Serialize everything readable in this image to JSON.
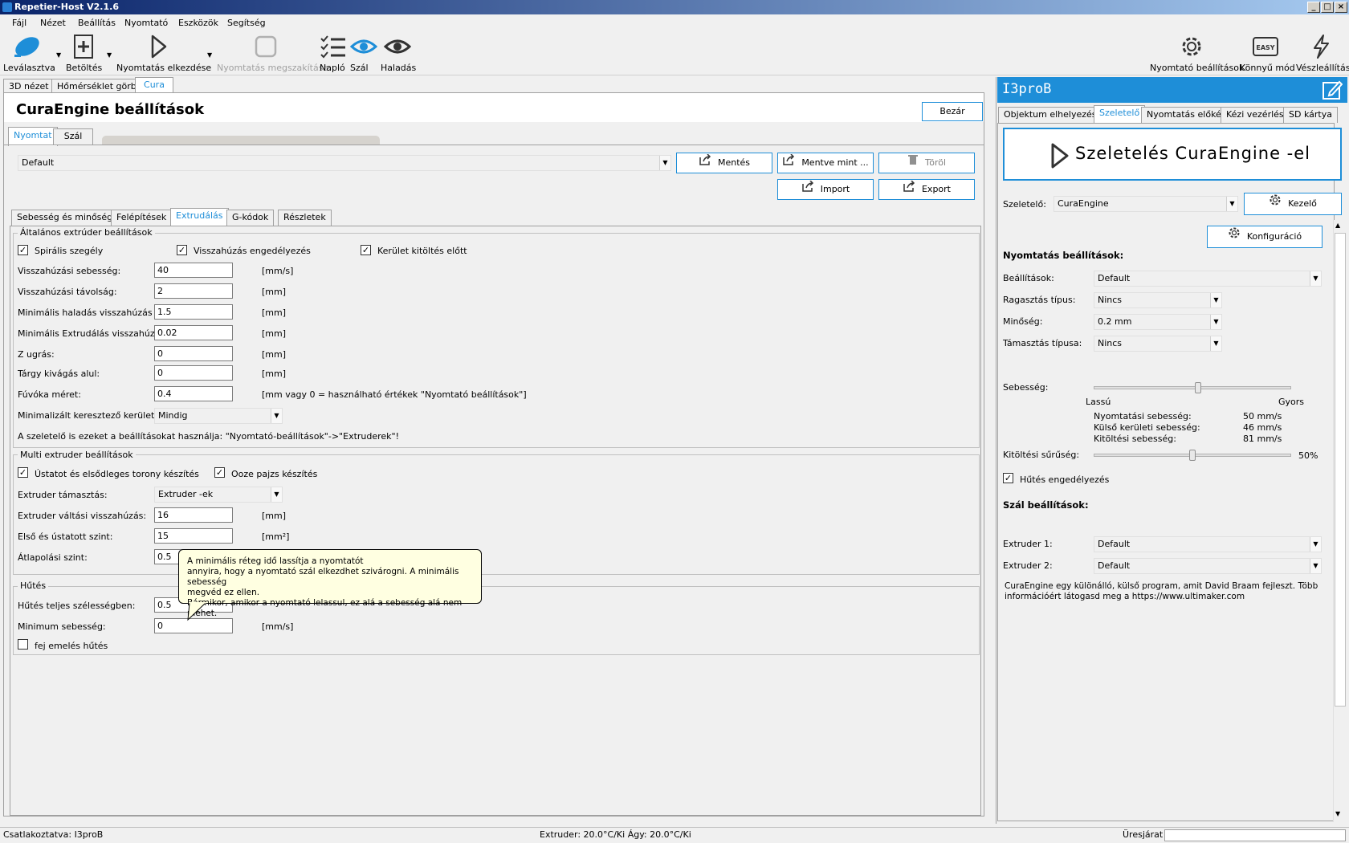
{
  "window": {
    "title": "Repetier-Host V2.1.6"
  },
  "menu": [
    "Fájl",
    "Nézet",
    "Beállítás",
    "Nyomtató",
    "Eszközök",
    "Segítség"
  ],
  "toolbar": {
    "disconnect": "Leválasztva",
    "load": "Betöltés",
    "start_print": "Nyomtatás elkezdése",
    "stop_print": "Nyomtatás megszakítása",
    "log": "Napló",
    "filament": "Szál",
    "travel": "Haladás",
    "printer_settings": "Nyomtató beállítások",
    "easy_mode": "Könnyű mód",
    "emergency_stop": "Vészleállítás",
    "easy_badge": "EASY"
  },
  "main_tabs": [
    "3D nézet",
    "Hőmérséklet görbe",
    "Cura"
  ],
  "cura": {
    "title": "CuraEngine beállítások",
    "close": "Bezár",
    "subtabs": [
      "Nyomtat",
      "Szál"
    ],
    "profile": "Default",
    "save": "Mentés",
    "save_as": "Mentve mint ...",
    "delete": "Töröl",
    "import": "Import",
    "export": "Export",
    "section_tabs": [
      "Sebesség és minőség",
      "Felépítések",
      "Extrudálás",
      "G-kódok",
      "Részletek"
    ],
    "general": {
      "title": "Általános extrúder beállítások",
      "chk_spiral": "Spirális szegély",
      "chk_retract": "Visszahúzás engedélyezés",
      "chk_perimeter": "Kerület kitöltés előtt",
      "rows": [
        {
          "label": "Visszahúzási sebesség:",
          "value": "40",
          "unit": "[mm/s]"
        },
        {
          "label": "Visszahúzási távolság:",
          "value": "2",
          "unit": "[mm]"
        },
        {
          "label": "Minimális haladás visszahúzás előtt:",
          "value": "1.5",
          "unit": "[mm]"
        },
        {
          "label": "Minimális Extrudálás visszahúzás előtt:",
          "value": "0.02",
          "unit": "[mm]"
        },
        {
          "label": "Z ugrás:",
          "value": "0",
          "unit": "[mm]"
        },
        {
          "label": "Tárgy kivágás alul:",
          "value": "0",
          "unit": "[mm]"
        },
        {
          "label": "Fúvóka méret:",
          "value": "0.4",
          "unit": "[mm vagy 0 = használható értékek \"Nyomtató beállítások\"]"
        }
      ],
      "min_cross_label": "Minimalizált keresztező kerületek:",
      "min_cross_value": "Mindig",
      "note": "A szeletelő is ezeket a beállításokat használja: \"Nyomtató-beállítások\"->\"Extruderek\"!"
    },
    "multi": {
      "title": "Multi extruder beállítások",
      "chk_tower": "Ústatot és elsődleges torony készítés",
      "chk_ooze": "Ooze pajzs készítés",
      "support_label": "Extruder támasztás:",
      "support_value": "Extruder -ek",
      "rows": [
        {
          "label": "Extruder váltási visszahúzás:",
          "value": "16",
          "unit": "[mm]"
        },
        {
          "label": "Első és ústatott szint:",
          "value": "15",
          "unit": "[mm²]"
        },
        {
          "label": "Átlapolási szint:",
          "value": "0.5",
          "unit": ""
        }
      ]
    },
    "cooling": {
      "title": "Hűtés",
      "rows": [
        {
          "label": "Hűtés teljes szélességben:",
          "value": "0.5",
          "unit": ""
        },
        {
          "label": "Minimum sebesség:",
          "value": "0",
          "unit": "[mm/s]"
        }
      ],
      "chk_head": "fej emelés hűtés"
    },
    "tooltip": [
      "A minimális réteg idő lassítja a nyomtatót",
      "annyira, hogy a nyomtató szál elkezdhet szivárogni.  A minimális sebesség",
      "megvéd ez ellen.",
      "Bármikor, amikor a nyomtató lelassul, ez alá a sebesség alá nem mehet."
    ]
  },
  "right": {
    "printer": "I3proB",
    "tabs": [
      "Objektum elhelyezése",
      "Szeletelő",
      "Nyomtatás előkép",
      "Kézi vezérlés",
      "SD kártya"
    ],
    "slice_button": "Szeletelés CuraEngine -el",
    "slicer_label": "Szeletelő:",
    "slicer_value": "CuraEngine",
    "manage": "Kezelő",
    "config": "Konfiguráció",
    "print_settings_title": "Nyomtatás beállítások:",
    "settings_label": "Beállítások:",
    "settings_value": "Default",
    "adhesion_label": "Ragasztás típus:",
    "adhesion_value": "Nincs",
    "quality_label": "Minőség:",
    "quality_value": "0.2 mm",
    "support_label": "Támasztás típusa:",
    "support_value": "Nincs",
    "speed_label": "Sebesség:",
    "speed_level": 0.53,
    "slow": "Lassú",
    "fast": "Gyors",
    "print_speed_label": "Nyomtatási sebesség:",
    "print_speed": "50 mm/s",
    "outer_speed_label": "Külső kerületi sebesség:",
    "outer_speed": "46 mm/s",
    "infill_speed_label": "Kitöltési sebesség:",
    "infill_speed": "81 mm/s",
    "infill_label": "Kitöltési sűrűség:",
    "infill_value": "50%",
    "infill_level": 0.5,
    "cooling": "Hűtés engedélyezés",
    "filament_title": "Szál beállítások:",
    "ext1_label": "Extruder 1:",
    "ext1_value": "Default",
    "ext2_label": "Extruder 2:",
    "ext2_value": "Default",
    "info_line1": "CuraEngine egy különálló, külső program, amit David Braam fejleszt. Több",
    "info_line2": "információért látogasd meg a https://www.ultimaker.com"
  },
  "status": {
    "connection": "Csatlakoztatva: I3proB",
    "temps": "Extruder: 20.0°C/Ki Ágy: 20.0°C/Ki",
    "queue": "Üresjárat"
  },
  "colors": {
    "accent": "#1e8ed8"
  }
}
